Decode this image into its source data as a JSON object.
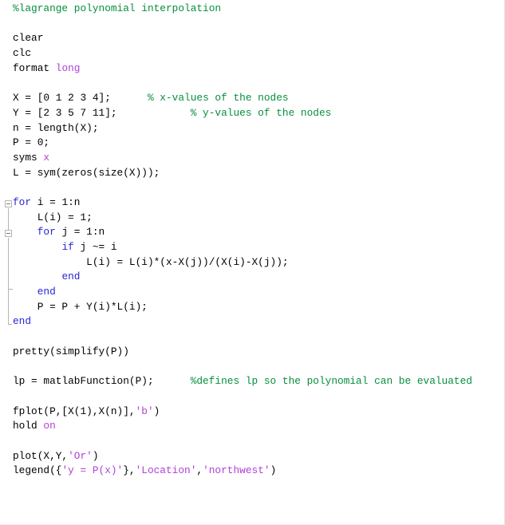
{
  "editor": {
    "app": "matlab-editor",
    "language": "MATLAB",
    "background_color": "#ffffff",
    "colors": {
      "comment": "#068e3c",
      "string": "#b140d8",
      "keyword": "#2a26d4",
      "text": "#000000",
      "fold_marker": "#b4b4b4"
    }
  },
  "code": {
    "lines": [
      {
        "segments": [
          {
            "text": "%lagrange polynomial interpolation",
            "type": "comment"
          }
        ]
      },
      {
        "segments": []
      },
      {
        "segments": [
          {
            "text": "clear",
            "type": "plain"
          }
        ]
      },
      {
        "segments": [
          {
            "text": "clc",
            "type": "plain"
          }
        ]
      },
      {
        "segments": [
          {
            "text": "format ",
            "type": "plain"
          },
          {
            "text": "long",
            "type": "string"
          }
        ]
      },
      {
        "segments": []
      },
      {
        "segments": [
          {
            "text": "X = [0 1 2 3 4];      ",
            "type": "plain"
          },
          {
            "text": "% x-values of the nodes",
            "type": "comment"
          }
        ]
      },
      {
        "segments": [
          {
            "text": "Y = [2 3 5 7 11];            ",
            "type": "plain"
          },
          {
            "text": "% y-values of the nodes",
            "type": "comment"
          }
        ]
      },
      {
        "segments": [
          {
            "text": "n = length(X);",
            "type": "plain"
          }
        ]
      },
      {
        "segments": [
          {
            "text": "P = 0;",
            "type": "plain"
          }
        ]
      },
      {
        "segments": [
          {
            "text": "syms ",
            "type": "plain"
          },
          {
            "text": "x",
            "type": "string"
          }
        ]
      },
      {
        "segments": [
          {
            "text": "L = sym(zeros(size(X)));",
            "type": "plain"
          }
        ]
      },
      {
        "segments": []
      },
      {
        "segments": [
          {
            "text": "for",
            "type": "keyword"
          },
          {
            "text": " i = 1:n",
            "type": "plain"
          }
        ]
      },
      {
        "segments": [
          {
            "text": "    L(i) = 1;",
            "type": "plain"
          }
        ]
      },
      {
        "segments": [
          {
            "text": "    ",
            "type": "plain"
          },
          {
            "text": "for",
            "type": "keyword"
          },
          {
            "text": " j = 1:n",
            "type": "plain"
          }
        ]
      },
      {
        "segments": [
          {
            "text": "        ",
            "type": "plain"
          },
          {
            "text": "if",
            "type": "keyword"
          },
          {
            "text": " j ~= i",
            "type": "plain"
          }
        ]
      },
      {
        "segments": [
          {
            "text": "            L(i) = L(i)*(x-X(j))/(X(i)-X(j));",
            "type": "plain"
          }
        ]
      },
      {
        "segments": [
          {
            "text": "        ",
            "type": "plain"
          },
          {
            "text": "end",
            "type": "keyword"
          }
        ]
      },
      {
        "segments": [
          {
            "text": "    ",
            "type": "plain"
          },
          {
            "text": "end",
            "type": "keyword"
          }
        ]
      },
      {
        "segments": [
          {
            "text": "    P = P + Y(i)*L(i);",
            "type": "plain"
          }
        ]
      },
      {
        "segments": [
          {
            "text": "end",
            "type": "keyword"
          }
        ]
      },
      {
        "segments": []
      },
      {
        "segments": [
          {
            "text": "pretty(simplify(P))",
            "type": "plain"
          }
        ]
      },
      {
        "segments": []
      },
      {
        "segments": [
          {
            "text": "lp = matlabFunction(P);      ",
            "type": "plain"
          },
          {
            "text": "%defines lp so the polynomial can be evaluated",
            "type": "comment"
          }
        ]
      },
      {
        "segments": []
      },
      {
        "segments": [
          {
            "text": "fplot(P,[X(1),X(n)],",
            "type": "plain"
          },
          {
            "text": "'b'",
            "type": "string"
          },
          {
            "text": ")",
            "type": "plain"
          }
        ]
      },
      {
        "segments": [
          {
            "text": "hold ",
            "type": "plain"
          },
          {
            "text": "on",
            "type": "string"
          }
        ]
      },
      {
        "segments": []
      },
      {
        "segments": [
          {
            "text": "plot(X,Y,",
            "type": "plain"
          },
          {
            "text": "'Or'",
            "type": "string"
          },
          {
            "text": ")",
            "type": "plain"
          }
        ]
      },
      {
        "segments": [
          {
            "text": "legend({",
            "type": "plain"
          },
          {
            "text": "'y = P(x)'",
            "type": "string"
          },
          {
            "text": "},",
            "type": "plain"
          },
          {
            "text": "'Location'",
            "type": "string"
          },
          {
            "text": ",",
            "type": "plain"
          },
          {
            "text": "'northwest'",
            "type": "string"
          },
          {
            "text": ")",
            "type": "plain"
          }
        ]
      }
    ]
  },
  "fold_markers": {
    "outer_for": {
      "label": "fold-outer-for-loop",
      "line": 13
    },
    "inner_for": {
      "label": "fold-inner-for-loop",
      "line": 15
    },
    "inner_end_tick": {
      "label": "fold-inner-end",
      "line": 19
    },
    "outer_end_corner": {
      "label": "fold-outer-end",
      "line": 21
    }
  }
}
